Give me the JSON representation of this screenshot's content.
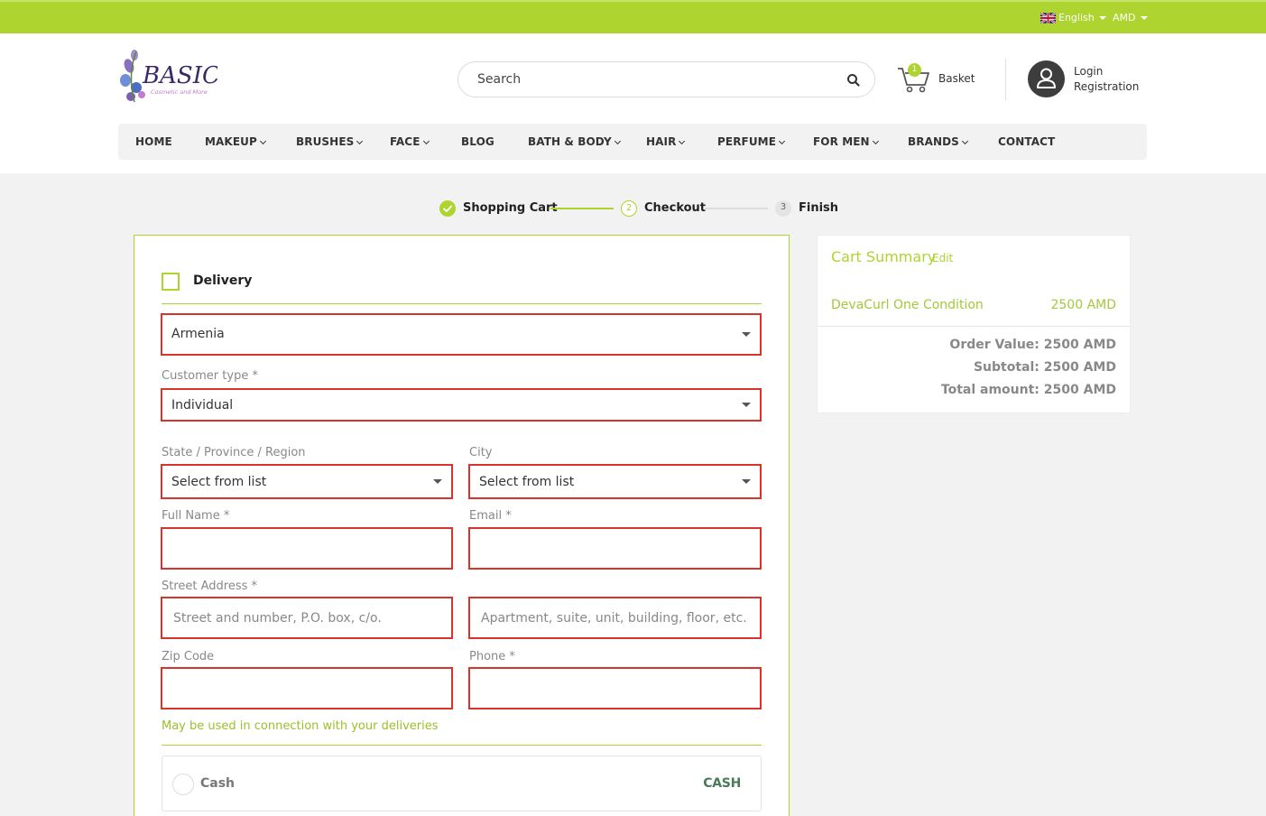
{
  "topbar": {
    "language": "English",
    "currency": "AMD",
    "accent_color": "#add42f"
  },
  "header": {
    "logo_text": "BASIC",
    "logo_tagline": "Cosmetic and More",
    "search_placeholder": "Search",
    "basket_label": "Basket",
    "basket_count": "1",
    "login_label": "Login",
    "registration_label": "Registration"
  },
  "nav": {
    "items": [
      {
        "label": "HOME"
      },
      {
        "label": "MAKEUP"
      },
      {
        "label": "BRUSHES"
      },
      {
        "label": "FACE"
      },
      {
        "label": "BLOG"
      },
      {
        "label": "BATH & BODY"
      },
      {
        "label": "HAIR"
      },
      {
        "label": "PERFUME"
      },
      {
        "label": "FOR MEN"
      },
      {
        "label": "BRANDS"
      },
      {
        "label": "CONTACT"
      }
    ]
  },
  "steps": {
    "step1": "Shopping Cart",
    "step2_num": "2",
    "step2": "Checkout",
    "step3_num": "3",
    "step3": "Finish"
  },
  "form": {
    "delivery_label": "Delivery",
    "country_value": "Armenia",
    "customer_type_label": "Customer type *",
    "customer_type_value": "Individual",
    "state_label": "State / Province / Region",
    "state_value": "Select from list",
    "city_label": "City",
    "city_value": "Select from list",
    "full_name_label": "Full Name *",
    "email_label": "Email *",
    "street_label": "Street Address *",
    "street_placeholder": "Street and number, P.O. box, c/o.",
    "apartment_placeholder": "Apartment, suite, unit, building, floor, etc.",
    "zip_label": "Zip Code",
    "phone_label": "Phone *",
    "note": "May be used in connection with your deliveries",
    "payment_label": "Cash",
    "payment_logo": "CASH"
  },
  "summary": {
    "title": "Cart Summary",
    "edit_label": "Edit",
    "item_name": "DevaCurl One Condition",
    "item_price": "2500 AMD",
    "order_value": "Order Value: 2500 AMD",
    "subtotal": "Subtotal: 2500 AMD",
    "total": "Total amount: 2500 AMD"
  }
}
